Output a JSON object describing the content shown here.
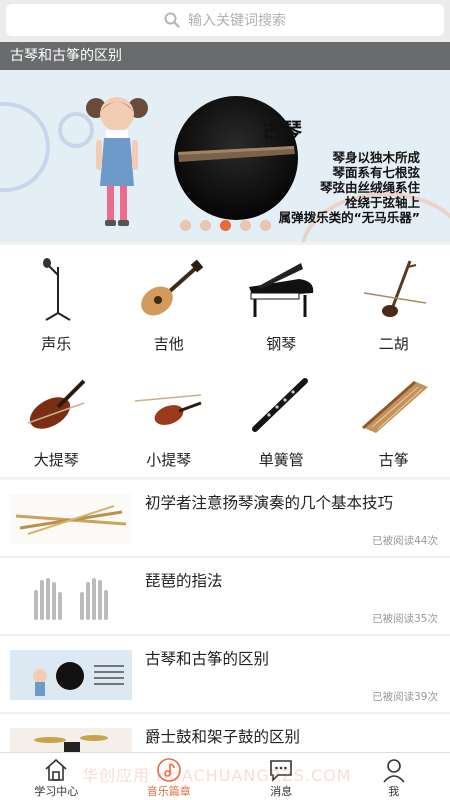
{
  "search": {
    "placeholder": "输入关键词搜索",
    "icon": "search-icon"
  },
  "banner": {
    "title": "古琴和古筝的区别",
    "slide_heading": "古琴",
    "slide_lines": [
      "琴身以独木所成",
      "琴面系有七根弦",
      "琴弦由丝绒绳系住",
      "栓绕于弦轴上",
      "属弹拨乐类的“无马乐器”"
    ],
    "dots_count": 5,
    "active_dot": 2,
    "colors": {
      "active_dot": "#e96a3a",
      "inactive_dot": "#e9c5b3"
    }
  },
  "instruments": [
    {
      "label": "声乐",
      "icon": "microphone-stand-icon"
    },
    {
      "label": "吉他",
      "icon": "guitar-icon"
    },
    {
      "label": "钢琴",
      "icon": "grand-piano-icon"
    },
    {
      "label": "二胡",
      "icon": "erhu-icon"
    },
    {
      "label": "大提琴",
      "icon": "cello-icon"
    },
    {
      "label": "小提琴",
      "icon": "violin-icon"
    },
    {
      "label": "单簧管",
      "icon": "clarinet-icon"
    },
    {
      "label": "古筝",
      "icon": "guzheng-icon"
    }
  ],
  "articles": [
    {
      "title": "初学者注意扬琴演奏的几个基本技巧",
      "read": "已被阅读44次"
    },
    {
      "title": "琵琶的指法",
      "read": "已被阅读35次"
    },
    {
      "title": "古琴和古筝的区别",
      "read": "已被阅读39次"
    },
    {
      "title": "爵士鼓和架子鼓的区别",
      "read": ""
    }
  ],
  "tabs": [
    {
      "label": "学习中心",
      "icon": "home-icon"
    },
    {
      "label": "音乐篇章",
      "icon": "music-note-icon"
    },
    {
      "label": "消息",
      "icon": "message-icon"
    },
    {
      "label": "我",
      "icon": "user-icon"
    }
  ],
  "active_tab": 1,
  "watermark": "华创应用 HUACHUANGRZS.COM",
  "accent_color": "#e86d3e"
}
